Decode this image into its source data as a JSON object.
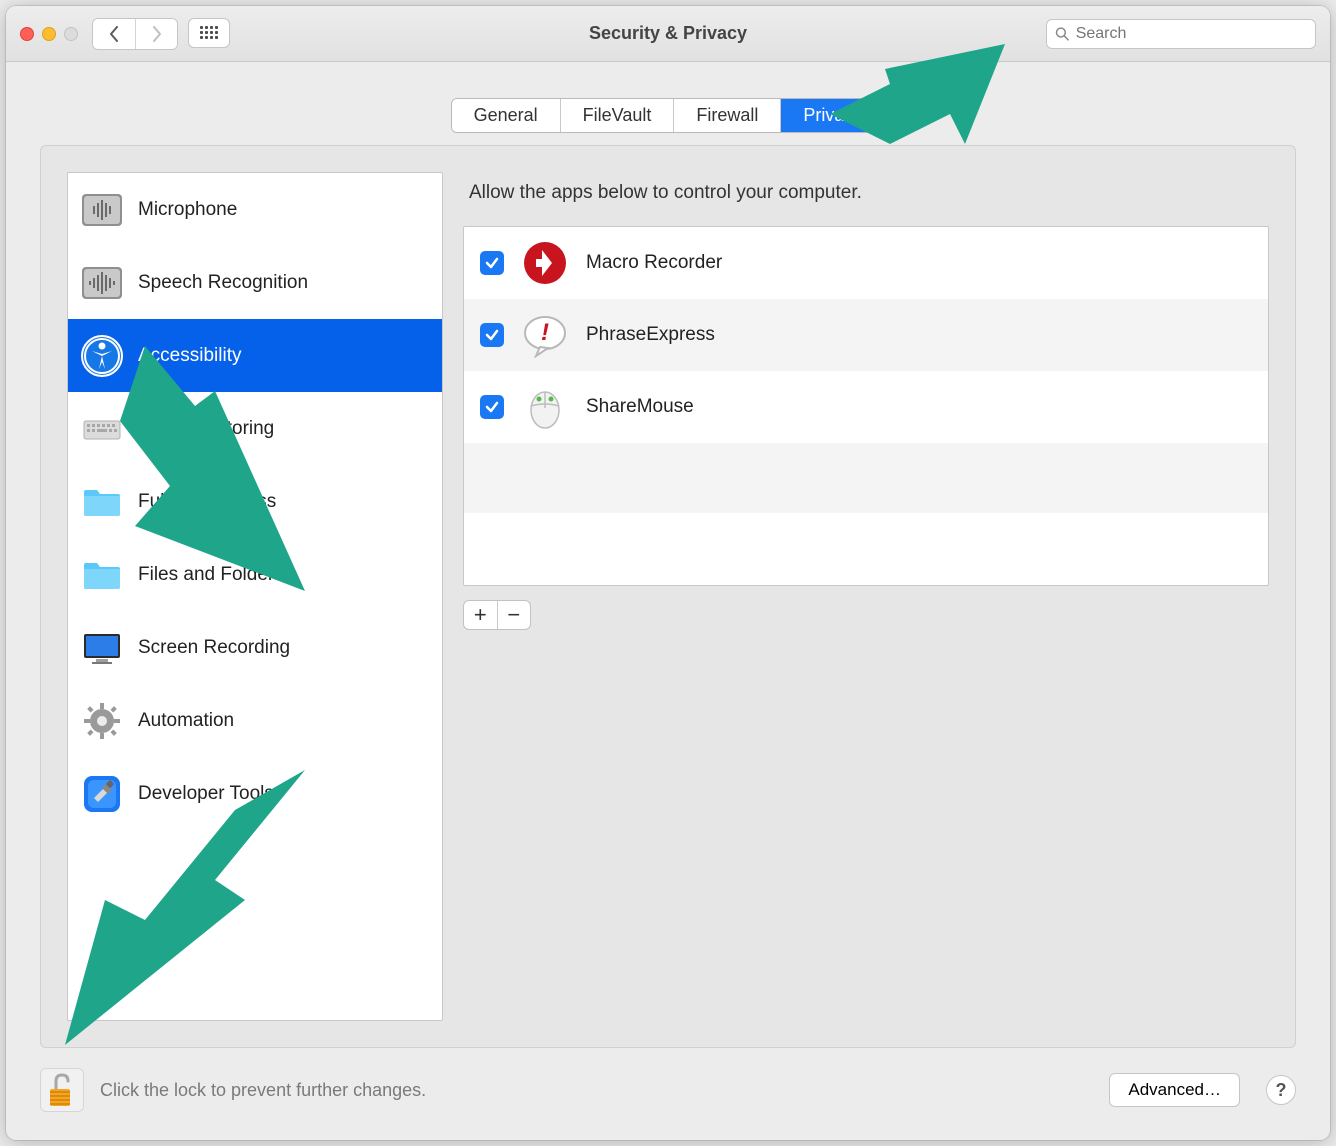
{
  "window": {
    "title": "Security & Privacy",
    "search_placeholder": "Search"
  },
  "tabs": [
    {
      "label": "General",
      "active": false
    },
    {
      "label": "FileVault",
      "active": false
    },
    {
      "label": "Firewall",
      "active": false
    },
    {
      "label": "Privacy",
      "active": true
    }
  ],
  "sidebar": {
    "items": [
      {
        "label": "Microphone",
        "icon": "microphone-icon",
        "selected": false
      },
      {
        "label": "Speech Recognition",
        "icon": "speech-icon",
        "selected": false
      },
      {
        "label": "Accessibility",
        "icon": "accessibility-icon",
        "selected": true
      },
      {
        "label": "Input Monitoring",
        "icon": "keyboard-icon",
        "selected": false
      },
      {
        "label": "Full Disk Access",
        "icon": "folder-icon",
        "selected": false
      },
      {
        "label": "Files and Folders",
        "icon": "folder-icon",
        "selected": false
      },
      {
        "label": "Screen Recording",
        "icon": "display-icon",
        "selected": false
      },
      {
        "label": "Automation",
        "icon": "gear-icon",
        "selected": false
      },
      {
        "label": "Developer Tools",
        "icon": "hammer-icon",
        "selected": false
      }
    ]
  },
  "right": {
    "description": "Allow the apps below to control your computer.",
    "apps": [
      {
        "name": "Macro Recorder",
        "checked": true,
        "icon": "macro-recorder-icon"
      },
      {
        "name": "PhraseExpress",
        "checked": true,
        "icon": "phraseexpress-icon"
      },
      {
        "name": "ShareMouse",
        "checked": true,
        "icon": "sharemouse-icon"
      }
    ],
    "add_label": "+",
    "remove_label": "−"
  },
  "footer": {
    "lock_text": "Click the lock to prevent further changes.",
    "advanced_label": "Advanced…",
    "help_label": "?"
  },
  "annotation_color": "#1fa58a"
}
